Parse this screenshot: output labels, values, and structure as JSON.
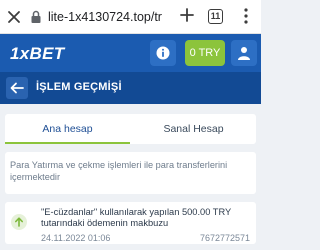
{
  "browser": {
    "url": "lite-1x4130724.top/tr",
    "tab_count": "11"
  },
  "header": {
    "logo_prefix": "1x",
    "logo_suffix": "BET",
    "balance": "0 TRY",
    "brand_color": "#1b5bb0",
    "accent_color": "#8cc43c"
  },
  "page": {
    "title": "İŞLEM GEÇMİŞİ"
  },
  "tabs": [
    {
      "label": "Ana hesap",
      "active": true
    },
    {
      "label": "Sanal Hesap",
      "active": false
    }
  ],
  "notice": "Para Yatırma ve çekme işlemleri ile para transferlerini içermektedir",
  "transactions": [
    {
      "description": "\"E-cüzdanlar\" kullanılarak yapılan 500.00 TRY tutarındaki ödemenin makbuzu",
      "date": "24.11.2022 01:06",
      "id": "7672772571",
      "icon": "arrow-up-icon"
    }
  ]
}
